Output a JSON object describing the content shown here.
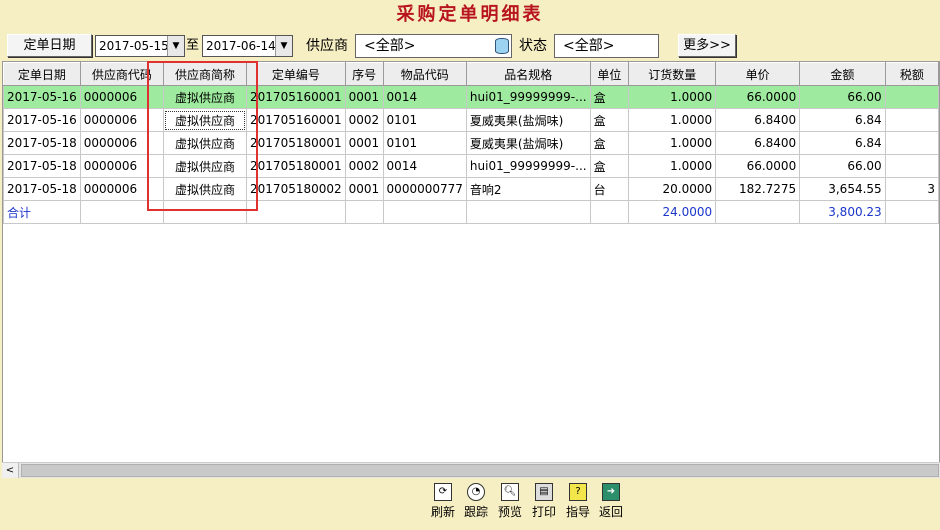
{
  "window": {
    "title": "采购定单明细表"
  },
  "toolbar": {
    "field_label": "定单日期",
    "date_from": "2017-05-15",
    "date_sep": "至",
    "date_to": "2017-06-14",
    "supplier_label": "供应商",
    "supplier_value": "<全部>",
    "status_label": "状态",
    "status_value": "<全部>",
    "more_label": "更多>>"
  },
  "grid": {
    "columns": [
      "定单日期",
      "供应商代码",
      "供应商简称",
      "定单编号",
      "序号",
      "物品代码",
      "品名规格",
      "单位",
      "订货数量",
      "单价",
      "金额",
      "税额"
    ],
    "rows": [
      [
        "2017-05-16",
        "0000006",
        "虚拟供应商",
        "201705160001",
        "0001",
        "0014",
        "hui01_99999999-...",
        "盒",
        "1.0000",
        "66.0000",
        "66.00",
        ""
      ],
      [
        "2017-05-16",
        "0000006",
        "虚拟供应商",
        "201705160001",
        "0002",
        "0101",
        "夏威夷果(盐焗味)",
        "盒",
        "1.0000",
        "6.8400",
        "6.84",
        ""
      ],
      [
        "2017-05-18",
        "0000006",
        "虚拟供应商",
        "201705180001",
        "0001",
        "0101",
        "夏威夷果(盐焗味)",
        "盒",
        "1.0000",
        "6.8400",
        "6.84",
        ""
      ],
      [
        "2017-05-18",
        "0000006",
        "虚拟供应商",
        "201705180001",
        "0002",
        "0014",
        "hui01_99999999-...",
        "盒",
        "1.0000",
        "66.0000",
        "66.00",
        ""
      ],
      [
        "2017-05-18",
        "0000006",
        "虚拟供应商",
        "201705180002",
        "0001",
        "0000000777",
        "音响2",
        "台",
        "20.0000",
        "182.7275",
        "3,654.55",
        "3"
      ]
    ],
    "total": {
      "label": "合计",
      "quantity": "24.0000",
      "amount": "3,800.23"
    }
  },
  "bottom": {
    "refresh": "刷新",
    "track": "跟踪",
    "preview": "预览",
    "print": "打印",
    "guide": "指导",
    "back": "返回"
  }
}
